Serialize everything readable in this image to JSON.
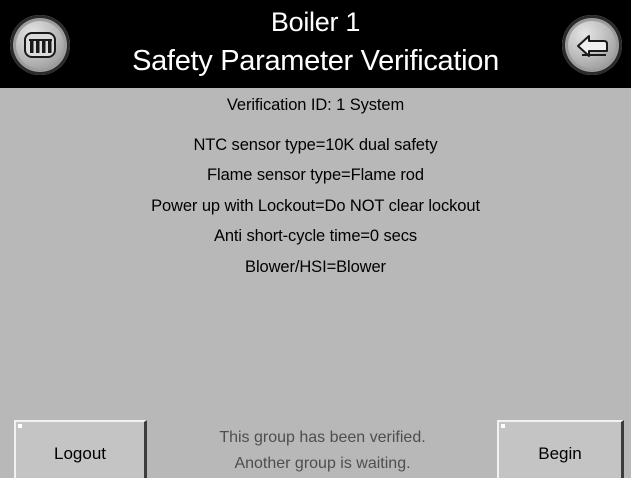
{
  "header": {
    "title": "Boiler 1",
    "subtitle": "Safety Parameter Verification",
    "left_icon": "boiler-home-icon",
    "right_icon": "back-arrow-icon"
  },
  "verification": {
    "id_line": "Verification ID:  1  System",
    "parameters": [
      "NTC sensor type=10K dual safety",
      "Flame sensor type=Flame rod",
      "Power up with Lockout=Do NOT clear lockout",
      "Anti short-cycle time=0 secs",
      "Blower/HSI=Blower"
    ]
  },
  "footer": {
    "logout_label": "Logout",
    "begin_label": "Begin",
    "status_line1": "This group has been verified.",
    "status_line2": "Another group is waiting."
  },
  "colors": {
    "background": "#b8b8b8",
    "header_bg": "#000000",
    "header_text": "#ffffff",
    "status_text": "#4e4e4e"
  }
}
